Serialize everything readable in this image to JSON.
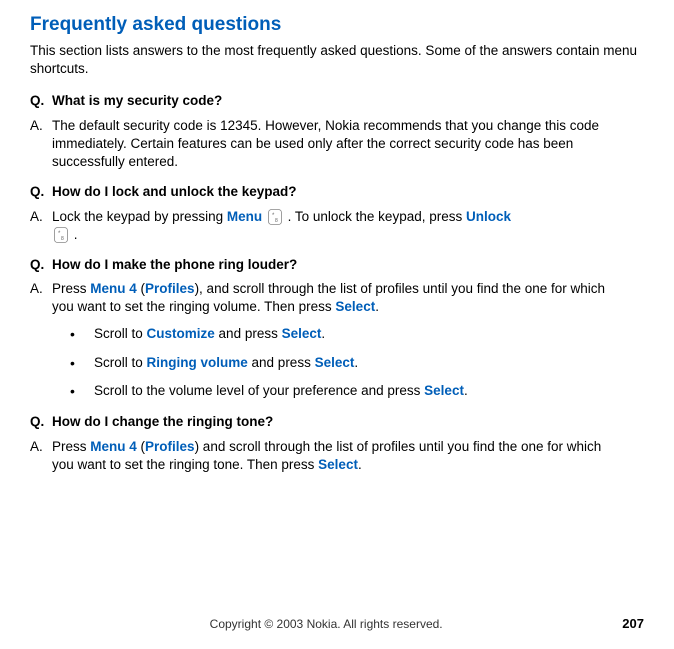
{
  "page_title": "Frequently asked questions",
  "intro": "This section lists answers to the most frequently asked questions. Some of the answers contain menu shortcuts.",
  "qa": [
    {
      "q_prefix": "Q.",
      "q_text": "What is my security code?",
      "a_prefix": "A.",
      "a_text": "The default security code is 12345. However, Nokia recommends that you change this code immediately. Certain features can be used only after the correct security code has been successfully entered."
    },
    {
      "q_prefix": "Q.",
      "q_text": "How do I lock and unlock the keypad?",
      "a_prefix": "A.",
      "a_parts": {
        "p1": "Lock the keypad by pressing ",
        "menu": "Menu",
        "p2": " . To unlock the keypad, press ",
        "unlock": "Unlock",
        "p3": " ."
      }
    },
    {
      "q_prefix": "Q.",
      "q_text": "How do I make the phone ring louder?",
      "a_prefix": "A.",
      "a_parts": {
        "p1": "Press ",
        "menu4": "Menu 4",
        "p2": " (",
        "profiles": "Profiles",
        "p3": "), and scroll through the list of profiles until you find the one for which you want to set the ringing volume. Then press ",
        "select": "Select",
        "p4": "."
      },
      "bullets": [
        {
          "p1": "Scroll to ",
          "hl1": "Customize",
          "p2": " and press ",
          "hl2": "Select",
          "p3": "."
        },
        {
          "p1": "Scroll to ",
          "hl1": "Ringing volume",
          "p2": " and press ",
          "hl2": "Select",
          "p3": "."
        },
        {
          "p1": "Scroll to the volume level of your preference and press ",
          "hl1": "Select",
          "p2": ".",
          "hl2": "",
          "p3": ""
        }
      ]
    },
    {
      "q_prefix": "Q.",
      "q_text": "How do I change the ringing tone?",
      "a_prefix": "A.",
      "a_parts": {
        "p1": "Press ",
        "menu4": "Menu 4",
        "p2": " (",
        "profiles": "Profiles",
        "p3": ") and scroll through the list of profiles until you find the one for which you want to set the ringing tone. Then press ",
        "select": "Select",
        "p4": "."
      }
    }
  ],
  "footer": {
    "copyright": "Copyright © 2003 Nokia. All rights reserved.",
    "page_num": "207"
  }
}
